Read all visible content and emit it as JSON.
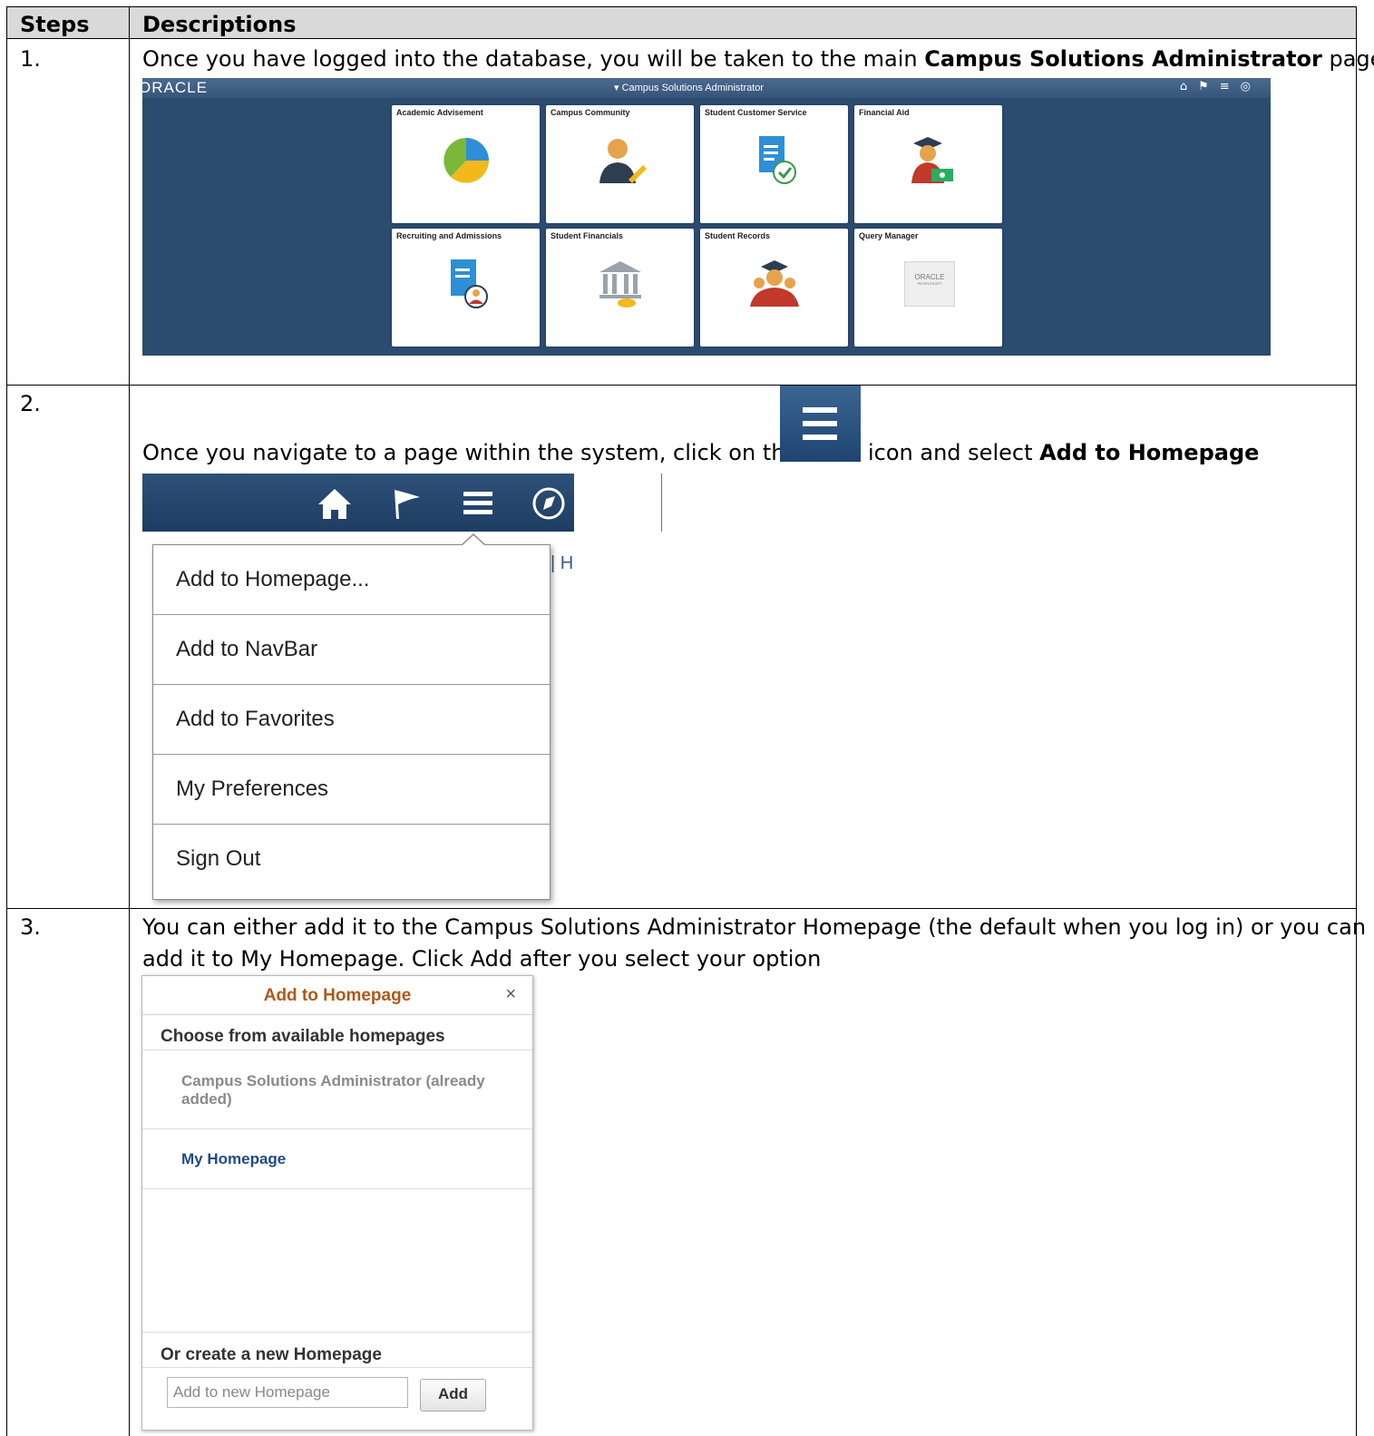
{
  "table": {
    "headers": [
      "Steps",
      "Descriptions"
    ],
    "rows": [
      {
        "step": "1.",
        "text_before": "Once you have logged into the database, you will be taken to the main ",
        "text_bold": "Campus Solutions Administrator",
        "text_after": " page."
      },
      {
        "step": "2.",
        "text_before": "Once you navigate to a page within the system, click on the",
        "text_middle": "icon and select ",
        "text_bold": "Add to Homepage"
      },
      {
        "step": "3.",
        "line1": "You can either add it to the Campus Solutions Administrator Homepage (the default when you log in) or you can",
        "line2": "add it to My Homepage.  Click Add after you select your option"
      }
    ]
  },
  "campus_screen": {
    "logo": "ORACLE",
    "title": "▾ Campus Solutions Administrator",
    "tiles": [
      {
        "label": "Academic Advisement",
        "icon": "pie-chart-icon"
      },
      {
        "label": "Campus Community",
        "icon": "person-pencil-icon"
      },
      {
        "label": "Student Customer Service",
        "icon": "document-check-icon"
      },
      {
        "label": "Financial Aid",
        "icon": "graduate-money-icon"
      },
      {
        "label": "Recruiting and Admissions",
        "icon": "document-person-icon"
      },
      {
        "label": "Student Financials",
        "icon": "bank-icon"
      },
      {
        "label": "Student Records",
        "icon": "graduates-icon"
      },
      {
        "label": "Query Manager",
        "icon": "oracle-peoplesoft-icon"
      }
    ],
    "query_logo_line1": "ORACLE",
    "query_logo_line2": "PEOPLESOFT"
  },
  "actions_menu": {
    "behind_text": "| H",
    "items": [
      "Add to Homepage...",
      "Add to NavBar",
      "Add to Favorites",
      "My Preferences",
      "Sign Out"
    ]
  },
  "add_dialog": {
    "title": "Add to Homepage",
    "close": "×",
    "choose_label": "Choose from available homepages",
    "option_disabled_line1": "Campus Solutions Administrator (already",
    "option_disabled_line2": "added)",
    "option_active": "My Homepage",
    "create_label": "Or create a new Homepage",
    "input_placeholder": "Add to new Homepage",
    "add_button": "Add"
  },
  "colors": {
    "header_bg": "#d9d9d9",
    "screen_bg": "#2b4b6f",
    "dialog_title": "#b0581a",
    "active_link": "#1f4a87"
  }
}
